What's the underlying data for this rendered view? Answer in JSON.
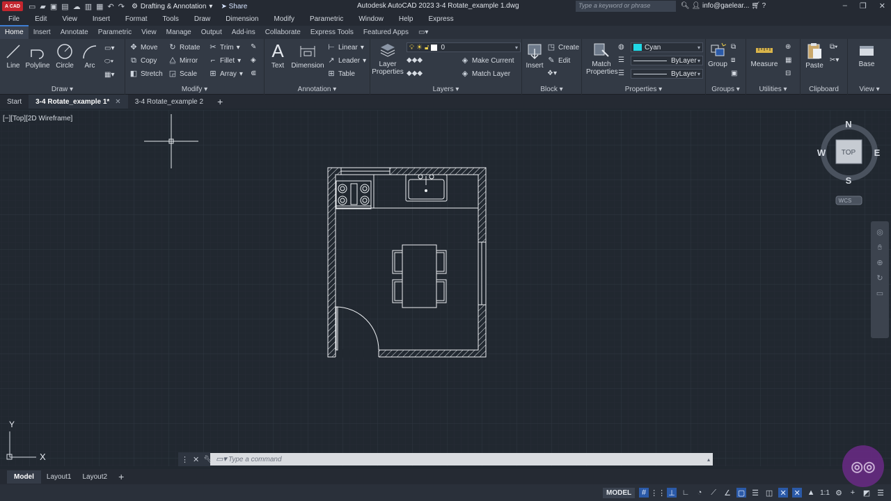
{
  "titlebar": {
    "logo_text": "A CAD",
    "workspace": "Drafting & Annotation",
    "share": "Share",
    "app_name": "Autodesk AutoCAD 2023",
    "document": "3-4 Rotate_example 1.dwg",
    "search_placeholder": "Type a keyword or phrase",
    "user": "info@gaelear..."
  },
  "menubar": {
    "items": [
      "File",
      "Edit",
      "View",
      "Insert",
      "Format",
      "Tools",
      "Draw",
      "Dimension",
      "Modify",
      "Parametric",
      "Window",
      "Help",
      "Express"
    ]
  },
  "ribbon_tabs": {
    "items": [
      "Home",
      "Insert",
      "Annotate",
      "Parametric",
      "View",
      "Manage",
      "Output",
      "Add-ins",
      "Collaborate",
      "Express Tools",
      "Featured Apps"
    ],
    "active": "Home"
  },
  "ribbon": {
    "draw": {
      "title": "Draw",
      "line": "Line",
      "polyline": "Polyline",
      "circle": "Circle",
      "arc": "Arc"
    },
    "modify": {
      "title": "Modify",
      "move": "Move",
      "rotate": "Rotate",
      "trim": "Trim",
      "copy": "Copy",
      "mirror": "Mirror",
      "fillet": "Fillet",
      "stretch": "Stretch",
      "scale": "Scale",
      "array": "Array"
    },
    "annotation": {
      "title": "Annotation",
      "text": "Text",
      "dimension": "Dimension",
      "linear": "Linear",
      "leader": "Leader",
      "table": "Table"
    },
    "layers": {
      "title": "Layers",
      "layer_properties_1": "Layer",
      "layer_properties_2": "Properties",
      "current_layer": "0",
      "make_current": "Make Current",
      "match_layer": "Match Layer"
    },
    "block": {
      "title": "Block",
      "insert": "Insert",
      "create": "Create",
      "edit": "Edit"
    },
    "properties": {
      "title": "Properties",
      "match_1": "Match",
      "match_2": "Properties",
      "color": "Cyan",
      "color_hex": "#21d8e6",
      "linetype": "ByLayer",
      "lineweight": "ByLayer"
    },
    "groups": {
      "title": "Groups",
      "group": "Group"
    },
    "utilities": {
      "title": "Utilities",
      "measure": "Measure"
    },
    "clipboard": {
      "title": "Clipboard",
      "paste": "Paste"
    },
    "view": {
      "title": "View",
      "base": "Base"
    }
  },
  "file_tabs": {
    "start": "Start",
    "tab1": "3-4 Rotate_example 1*",
    "tab2": "3-4 Rotate_example 2",
    "add": "+"
  },
  "viewport": {
    "label": "[−][Top][2D Wireframe]",
    "viewcube": {
      "n": "N",
      "s": "S",
      "e": "E",
      "w": "W",
      "face": "TOP",
      "wcs": "WCS"
    },
    "ucs": {
      "x": "X",
      "y": "Y"
    }
  },
  "command": {
    "placeholder": "Type a command"
  },
  "layout_tabs": {
    "items": [
      "Model",
      "Layout1",
      "Layout2"
    ],
    "active": "Model",
    "add": "+"
  },
  "statusbar": {
    "model": "MODEL",
    "scale": "1:1"
  }
}
